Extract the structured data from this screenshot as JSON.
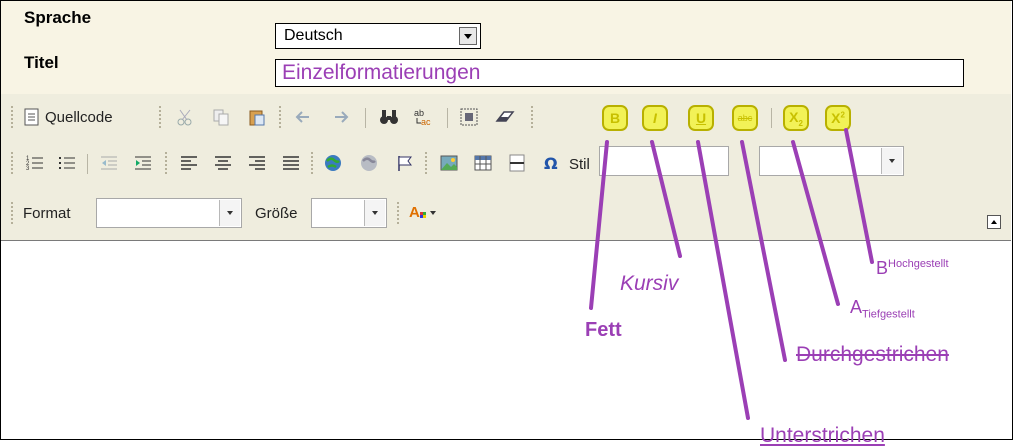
{
  "header": {
    "language_label": "Sprache",
    "language_value": "Deutsch",
    "title_label": "Titel",
    "title_value": "Einzelformatierungen"
  },
  "toolbar": {
    "source_label": "Quellcode",
    "style_label": "Stil",
    "format_label": "Format",
    "size_label": "Größe",
    "bold_letter": "B",
    "italic_letter": "I",
    "underline_letter": "U",
    "strike_letter": "abc",
    "sub_letter": "X",
    "sub_index": "2",
    "sup_letter": "X",
    "sup_index": "2"
  },
  "annotations": {
    "bold": "Fett",
    "italic": "Kursiv",
    "underline": "Unterstrichen",
    "strike": "Durchgestrichen",
    "subscript_base": "A",
    "subscript_text": "Tiefgestellt",
    "superscript_base": "B",
    "superscript_text": "Hochgestellt"
  },
  "colors": {
    "annotation": "#9b3fb5",
    "highlight": "#f2f257",
    "toolbar_bg": "#efedde",
    "header_bg": "#f8f4e4"
  },
  "icons": [
    "source-icon",
    "cut-icon",
    "copy-icon",
    "paste-icon",
    "undo-icon",
    "redo-icon",
    "find-icon",
    "replace-icon",
    "select-all-icon",
    "eraser-icon",
    "ordered-list-icon",
    "unordered-list-icon",
    "outdent-icon",
    "indent-icon",
    "align-left-icon",
    "align-center-icon",
    "align-right-icon",
    "justify-icon",
    "link-icon",
    "unlink-icon",
    "anchor-icon",
    "image-icon",
    "table-icon",
    "horizontal-rule-icon",
    "omega-icon",
    "text-color-icon"
  ]
}
